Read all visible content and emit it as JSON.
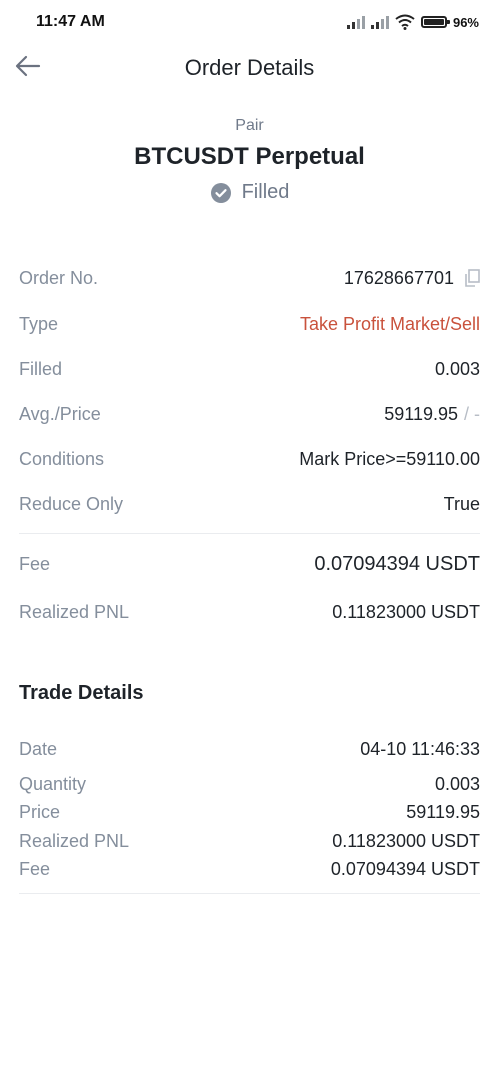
{
  "status_bar": {
    "time": "11:47 AM",
    "battery": "96%"
  },
  "header": {
    "title": "Order Details"
  },
  "pair": {
    "label": "Pair",
    "name": "BTCUSDT Perpetual",
    "status": "Filled"
  },
  "order": {
    "order_no_label": "Order No.",
    "order_no_value": "17628667701",
    "type_label": "Type",
    "type_value": "Take Profit Market/Sell",
    "filled_label": "Filled",
    "filled_value": "0.003",
    "avg_price_label": "Avg./Price",
    "avg_price_value": "59119.95",
    "avg_price_suffix": "/ -",
    "conditions_label": "Conditions",
    "conditions_value": "Mark Price>=59110.00",
    "reduce_only_label": "Reduce Only",
    "reduce_only_value": "True",
    "fee_label": "Fee",
    "fee_value": "0.07094394 USDT",
    "realized_pnl_label": "Realized PNL",
    "realized_pnl_value": "0.11823000 USDT"
  },
  "trade": {
    "section_title": "Trade Details",
    "date_label": "Date",
    "date_value": "04-10 11:46:33",
    "quantity_label": "Quantity",
    "quantity_value": "0.003",
    "price_label": "Price",
    "price_value": "59119.95",
    "realized_pnl_label": "Realized PNL",
    "realized_pnl_value": "0.11823000 USDT",
    "fee_label": "Fee",
    "fee_value": "0.07094394 USDT"
  },
  "colors": {
    "accent_red": "#c9523c",
    "label_gray": "#848e9c",
    "text_dark": "#1e2329"
  }
}
